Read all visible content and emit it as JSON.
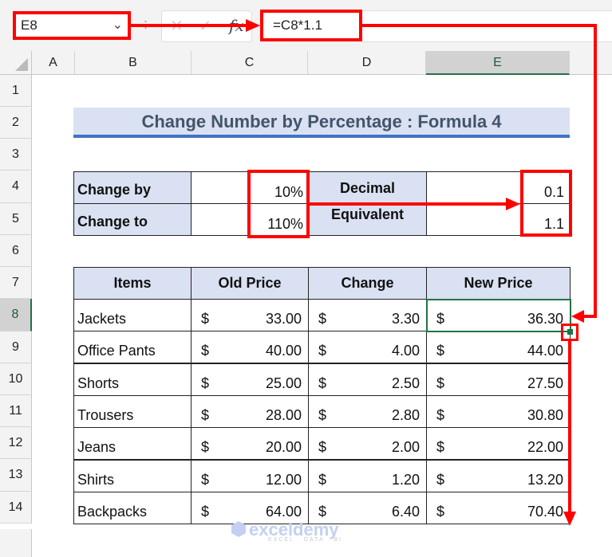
{
  "formula_bar": {
    "name_box": "E8",
    "name_box_chevron": "⌄",
    "separator": ":",
    "cancel_icon": "✕",
    "enter_icon": "✓",
    "fx_label": "fx",
    "formula": "=C8*1.1"
  },
  "columns": [
    "A",
    "B",
    "C",
    "D",
    "E"
  ],
  "selected_column": "E",
  "rows": [
    "1",
    "2",
    "3",
    "4",
    "5",
    "6",
    "7",
    "8",
    "9",
    "10",
    "11",
    "12",
    "13",
    "14"
  ],
  "selected_row": "8",
  "title": "Change Number by Percentage : Formula 4",
  "inputs": {
    "change_by_label": "Change by",
    "change_by_value": "10%",
    "change_to_label": "Change to",
    "change_to_value": "110%",
    "decimal_label": "Decimal Equivalent",
    "decimal_line1": "Decimal",
    "decimal_line2": "Equivalent",
    "decimal_by": "0.1",
    "decimal_to": "1.1"
  },
  "table": {
    "headers": [
      "Items",
      "Old Price",
      "Change",
      "New Price"
    ],
    "currency": "$",
    "rows": [
      {
        "item": "Jackets",
        "old": "33.00",
        "change": "3.30",
        "new": "36.30"
      },
      {
        "item": "Office Pants",
        "old": "40.00",
        "change": "4.00",
        "new": "44.00"
      },
      {
        "item": "Shorts",
        "old": "25.00",
        "change": "2.50",
        "new": "27.50"
      },
      {
        "item": "Trousers",
        "old": "28.00",
        "change": "2.80",
        "new": "30.80"
      },
      {
        "item": "Jeans",
        "old": "20.00",
        "change": "2.00",
        "new": "22.00"
      },
      {
        "item": "Shirts",
        "old": "12.00",
        "change": "1.20",
        "new": "13.20"
      },
      {
        "item": "Backpacks",
        "old": "64.00",
        "change": "6.40",
        "new": "70.40"
      }
    ]
  },
  "watermark": {
    "name": "exceldemy",
    "tagline": "EXCEL · DATA · BI"
  },
  "colors": {
    "accent_red": "#ff0000",
    "excel_green": "#217346",
    "header_fill": "#d9e1f2",
    "title_text": "#44546a",
    "title_underline": "#4472c4"
  }
}
